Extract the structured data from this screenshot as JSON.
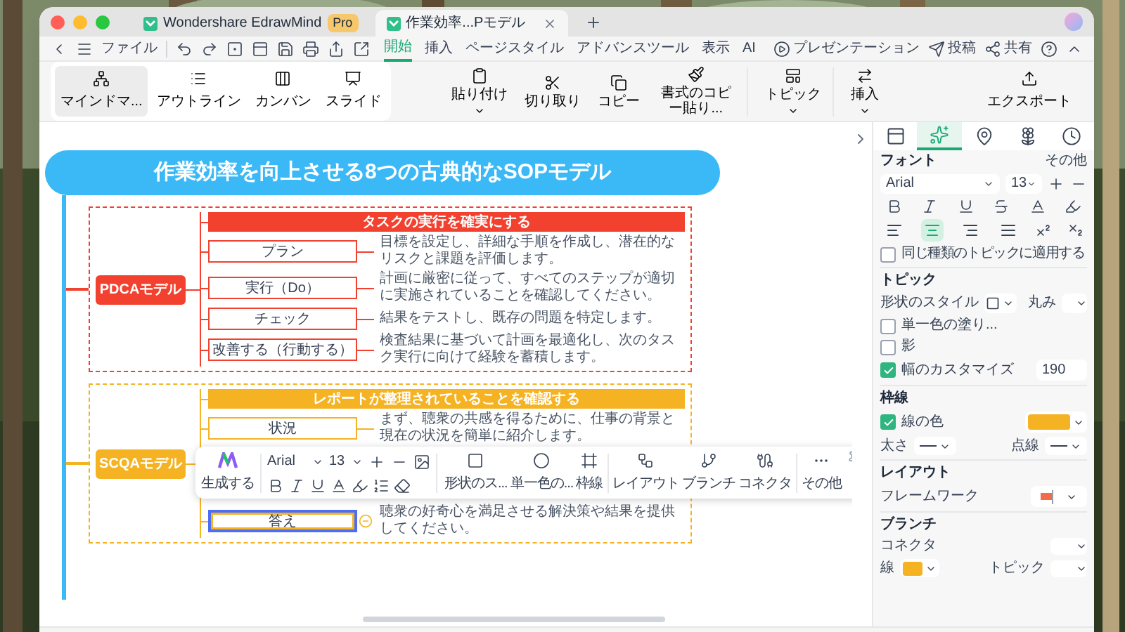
{
  "window": {
    "tabs": [
      {
        "label": "Wondershare EdrawMind",
        "badge": "Pro",
        "selected": false
      },
      {
        "label": "作業効率...Pモデル",
        "selected": true
      }
    ]
  },
  "menu_bar": {
    "file": "ファイル",
    "tabs": [
      {
        "label": "開始",
        "selected": true
      },
      {
        "label": "挿入",
        "selected": false
      },
      {
        "label": "ページスタイル",
        "selected": false
      },
      {
        "label": "アドバンスツール",
        "selected": false
      },
      {
        "label": "表示",
        "selected": false
      },
      {
        "label": "AI",
        "selected": false
      }
    ],
    "actions": [
      {
        "kind": "present",
        "label": "プレゼンテーション"
      },
      {
        "kind": "post",
        "label": "投稿"
      },
      {
        "kind": "share",
        "label": "共有"
      }
    ]
  },
  "ribbon": {
    "views": [
      {
        "kind": "mindmap",
        "label": "マインドマ...",
        "selected": true
      },
      {
        "kind": "outline",
        "label": "アウトライン",
        "selected": false
      },
      {
        "kind": "kanban",
        "label": "カンバン",
        "selected": false
      },
      {
        "kind": "slide",
        "label": "スライド",
        "selected": false
      }
    ],
    "tools": [
      {
        "kind": "paste",
        "label": "貼り付け",
        "dropdown": true
      },
      {
        "kind": "cut",
        "label": "切り取り",
        "dropdown": false
      },
      {
        "kind": "copy",
        "label": "コピー",
        "dropdown": false
      },
      {
        "kind": "format",
        "label": "書式のコピー貼り...",
        "dropdown": false
      },
      {
        "kind": "topic",
        "label": "トピック",
        "dropdown": true
      },
      {
        "kind": "insert",
        "label": "挿入",
        "dropdown": true
      }
    ],
    "export": "エクスポート"
  },
  "mindmap": {
    "title": "作業効率を向上させる8つの古典的なSOPモデル",
    "frames": [
      {
        "main": "PDCAモデル",
        "header": "タスクの実行を確実にする",
        "color": "#f2412f",
        "items": [
          {
            "label": "プラン",
            "description": "目標を設定し、詳細な手順を作成し、潜在的なリスクと課題を評価します。",
            "selected": false
          },
          {
            "label": "実行（Do）",
            "description": "計画に厳密に従って、すべてのステップが適切に実施されていることを確認してください。",
            "selected": false
          },
          {
            "label": "チェック",
            "description": "結果をテストし、既存の問題を特定します。",
            "selected": false
          },
          {
            "label": "改善する（行動する）",
            "description": "検査結果に基づいて計画を最適化し、次のタスク実行に向けて経験を蓄積します。",
            "selected": false
          }
        ]
      },
      {
        "main": "SCQAモデル",
        "header": "レポートが整理されていることを確認する",
        "color": "#f5b324",
        "items": [
          {
            "label": "状況",
            "description": "まず、聴衆の共感を得るために、仕事の背景と現在の状況を簡単に紹介します。",
            "selected": false
          },
          {
            "kind": "hidden"
          },
          {
            "label": "答え",
            "description": "聴衆の好奇心を満足させる解決策や結果を提供してください。",
            "selected": true
          }
        ]
      }
    ]
  },
  "floating_toolbar": {
    "ai": "生成する",
    "font": "Arial",
    "size": "13",
    "tools": [
      {
        "kind": "shape",
        "label": "形状のス..."
      },
      {
        "kind": "fill",
        "label": "単一色の..."
      },
      {
        "kind": "border",
        "label": "枠線"
      },
      {
        "kind": "layout",
        "label": "レイアウト"
      },
      {
        "kind": "branch",
        "label": "ブランチ"
      },
      {
        "kind": "connector",
        "label": "コネクタ"
      },
      {
        "kind": "more",
        "label": "その他"
      }
    ]
  },
  "right_panel": {
    "tabs": [
      {
        "kind": "style",
        "selected": false
      },
      {
        "kind": "ai",
        "selected": true
      },
      {
        "kind": "mark",
        "selected": false
      },
      {
        "kind": "theme",
        "selected": false
      },
      {
        "kind": "history",
        "selected": false
      }
    ],
    "font": {
      "title": "フォント",
      "more": "その他",
      "family": "Arial",
      "size": "13",
      "align": [
        {
          "kind": "left",
          "selected": false
        },
        {
          "kind": "center",
          "selected": true
        },
        {
          "kind": "right",
          "selected": false
        },
        {
          "kind": "justify",
          "selected": false
        }
      ],
      "apply_same": {
        "label": "同じ種類のトピックに適用する",
        "checked": false
      }
    },
    "topic": {
      "title": "トピック",
      "shape_style": "形状のスタイル",
      "rounding": "丸み",
      "fill": {
        "label": "単一色の塗り...",
        "checked": false
      },
      "shadow": {
        "label": "影",
        "checked": false
      },
      "custom_width": {
        "label": "幅のカスタマイズ",
        "checked": true,
        "value": "190"
      }
    },
    "border": {
      "title": "枠線",
      "line_color": {
        "label": "線の色",
        "checked": true,
        "color": "#f5b324"
      },
      "thickness": "太さ",
      "dash": "点線"
    },
    "layout": {
      "title": "レイアウト",
      "framework": "フレームワーク"
    },
    "branch": {
      "title": "ブランチ",
      "connector": "コネクタ",
      "line": {
        "label": "線",
        "color": "#f5b324"
      },
      "topic": "トピック"
    }
  }
}
